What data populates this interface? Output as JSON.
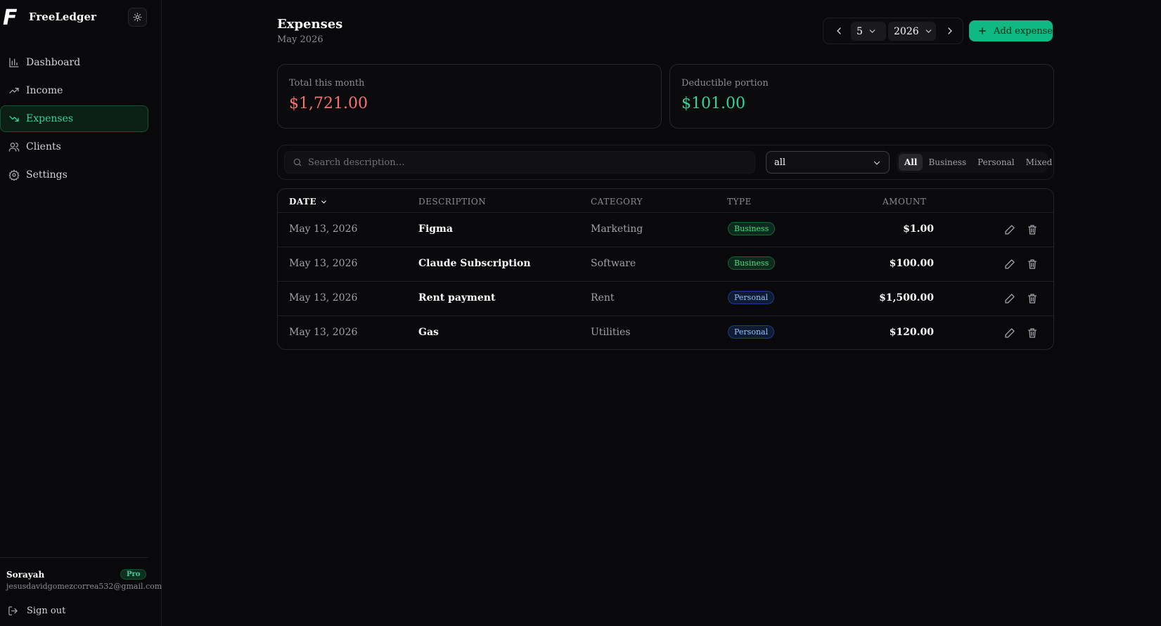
{
  "app": {
    "logo": "F",
    "name": "FreeLedger"
  },
  "sidebar": {
    "items": [
      {
        "label": "Dashboard",
        "icon": "chart-icon"
      },
      {
        "label": "Income",
        "icon": "trending-up-icon"
      },
      {
        "label": "Expenses",
        "icon": "trending-down-icon",
        "active": true
      },
      {
        "label": "Clients",
        "icon": "users-icon"
      },
      {
        "label": "Settings",
        "icon": "gear-icon"
      }
    ],
    "user": {
      "name": "Sorayah",
      "email": "jesusdavidgomezcorrea532@gmail.com",
      "plan": "Pro"
    },
    "signout_label": "Sign out"
  },
  "header": {
    "title": "Expenses",
    "subtitle": "May 2026",
    "month_value": "5",
    "year_value": "2026",
    "add_label": "Add expense"
  },
  "summary": {
    "total_label": "Total this month",
    "total_value": "$1,721.00",
    "deductible_label": "Deductible portion",
    "deductible_value": "$101.00"
  },
  "filters": {
    "search_placeholder": "Search description…",
    "category_value": "all",
    "segments": [
      "All",
      "Business",
      "Personal",
      "Mixed"
    ],
    "active_segment": "All"
  },
  "table": {
    "columns": [
      "DATE",
      "DESCRIPTION",
      "CATEGORY",
      "TYPE",
      "AMOUNT"
    ],
    "rows": [
      {
        "date": "May 13, 2026",
        "description": "Figma",
        "category": "Marketing",
        "type": "Business",
        "amount": "$1.00"
      },
      {
        "date": "May 13, 2026",
        "description": "Claude Subscription",
        "category": "Software",
        "type": "Business",
        "amount": "$100.00"
      },
      {
        "date": "May 13, 2026",
        "description": "Rent payment",
        "category": "Rent",
        "type": "Personal",
        "amount": "$1,500.00"
      },
      {
        "date": "May 13, 2026",
        "description": "Gas",
        "category": "Utilities",
        "type": "Personal",
        "amount": "$120.00"
      }
    ]
  },
  "colors": {
    "accent": "#10b981",
    "negative": "#f87171",
    "positive": "#34d399",
    "business_badge": "#4ade80",
    "personal_badge": "#93c5fd"
  }
}
